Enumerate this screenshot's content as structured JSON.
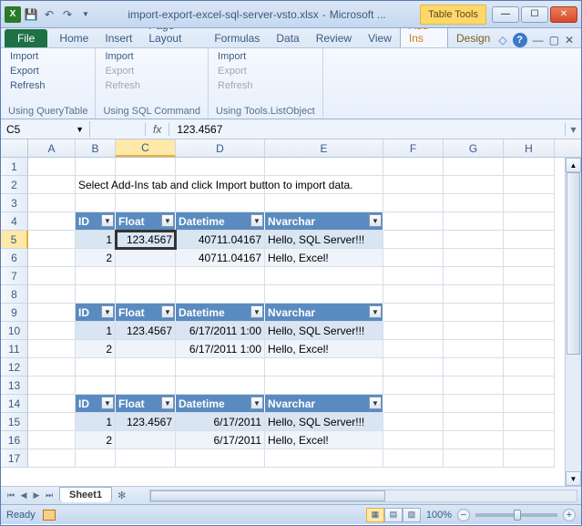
{
  "window": {
    "filename": "import-export-excel-sql-server-vsto.xlsx",
    "app": "Microsoft ...",
    "context_tab": "Table Tools"
  },
  "tabs": {
    "file": "File",
    "home": "Home",
    "insert": "Insert",
    "page_layout": "Page Layout",
    "formulas": "Formulas",
    "data": "Data",
    "review": "Review",
    "view": "View",
    "addins": "Add-Ins",
    "design": "Design"
  },
  "ribbon": {
    "groups": [
      {
        "label": "Using QueryTable",
        "items": [
          "Import",
          "Export",
          "Refresh"
        ],
        "enabled": [
          true,
          true,
          true
        ]
      },
      {
        "label": "Using SQL Command",
        "items": [
          "Import",
          "Export",
          "Refresh"
        ],
        "enabled": [
          true,
          false,
          false
        ]
      },
      {
        "label": "Using Tools.ListObject",
        "items": [
          "Import",
          "Export",
          "Refresh"
        ],
        "enabled": [
          true,
          false,
          false
        ]
      }
    ]
  },
  "formula_bar": {
    "name_box": "C5",
    "fx": "fx",
    "value": "123.4567"
  },
  "columns": [
    "A",
    "B",
    "C",
    "D",
    "E",
    "F",
    "G",
    "H"
  ],
  "selected_col": "C",
  "selected_row": 5,
  "message_row": 2,
  "message": "Select Add-Ins tab  and click Import button to import data.",
  "table_headers": [
    "ID",
    "Float",
    "Datetime",
    "Nvarchar"
  ],
  "tables": [
    {
      "header_row": 4,
      "rows": [
        {
          "r": 5,
          "d": [
            "1",
            "123.4567",
            "40711.04167",
            "Hello, SQL Server!!!"
          ]
        },
        {
          "r": 6,
          "d": [
            "2",
            "",
            "40711.04167",
            "Hello, Excel!"
          ]
        }
      ]
    },
    {
      "header_row": 9,
      "rows": [
        {
          "r": 10,
          "d": [
            "1",
            "123.4567",
            "6/17/2011 1:00",
            "Hello, SQL Server!!!"
          ]
        },
        {
          "r": 11,
          "d": [
            "2",
            "",
            "6/17/2011 1:00",
            "Hello, Excel!"
          ]
        }
      ]
    },
    {
      "header_row": 14,
      "rows": [
        {
          "r": 15,
          "d": [
            "1",
            "123.4567",
            "6/17/2011",
            "Hello, SQL Server!!!"
          ]
        },
        {
          "r": 16,
          "d": [
            "2",
            "",
            "6/17/2011",
            "Hello, Excel!"
          ]
        }
      ]
    }
  ],
  "sheet": {
    "name": "Sheet1"
  },
  "status": {
    "ready": "Ready",
    "zoom": "100%"
  }
}
